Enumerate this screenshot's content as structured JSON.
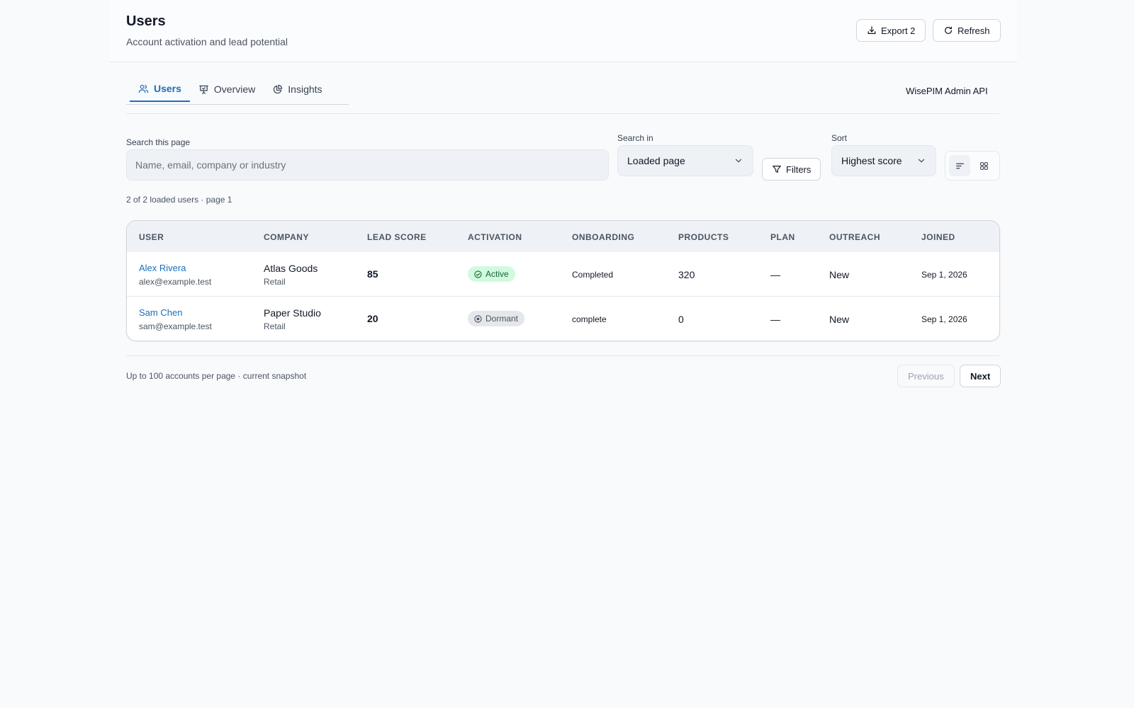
{
  "header": {
    "title": "Users",
    "subtitle": "Account activation and lead potential",
    "export_label": "Export 2",
    "refresh_label": "Refresh"
  },
  "tabs": [
    {
      "label": "Users",
      "icon": "users-icon",
      "active": true
    },
    {
      "label": "Overview",
      "icon": "presentation-icon",
      "active": false
    },
    {
      "label": "Insights",
      "icon": "pie-chart-icon",
      "active": false
    }
  ],
  "api_label": "WisePIM Admin API",
  "search": {
    "label": "Search this page",
    "placeholder": "Name, email, company or industry",
    "value": ""
  },
  "search_in": {
    "label": "Search in",
    "value": "Loaded page"
  },
  "filters_label": "Filters",
  "sort": {
    "label": "Sort",
    "value": "Highest score"
  },
  "count_text": "2 of 2 loaded users · page 1",
  "table": {
    "columns": [
      "USER",
      "COMPANY",
      "LEAD SCORE",
      "ACTIVATION",
      "ONBOARDING",
      "PRODUCTS",
      "PLAN",
      "OUTREACH",
      "JOINED"
    ],
    "rows": [
      {
        "name": "Alex Rivera",
        "email": "alex@example.test",
        "company": "Atlas Goods",
        "industry": "Retail",
        "lead_score": "85",
        "activation": "Active",
        "onboarding": "Completed",
        "products": "320",
        "plan": "—",
        "outreach": "New",
        "joined": "Sep 1, 2026"
      },
      {
        "name": "Sam Chen",
        "email": "sam@example.test",
        "company": "Paper Studio",
        "industry": "Retail",
        "lead_score": "20",
        "activation": "Dormant",
        "onboarding": "complete",
        "products": "0",
        "plan": "—",
        "outreach": "New",
        "joined": "Sep 1, 2026"
      }
    ]
  },
  "footer": {
    "text": "Up to 100 accounts per page · current snapshot",
    "previous_label": "Previous",
    "next_label": "Next"
  },
  "colors": {
    "accent": "#1d6fb8",
    "active_badge": "#d1fadf",
    "dormant_badge": "#e5e7eb"
  }
}
